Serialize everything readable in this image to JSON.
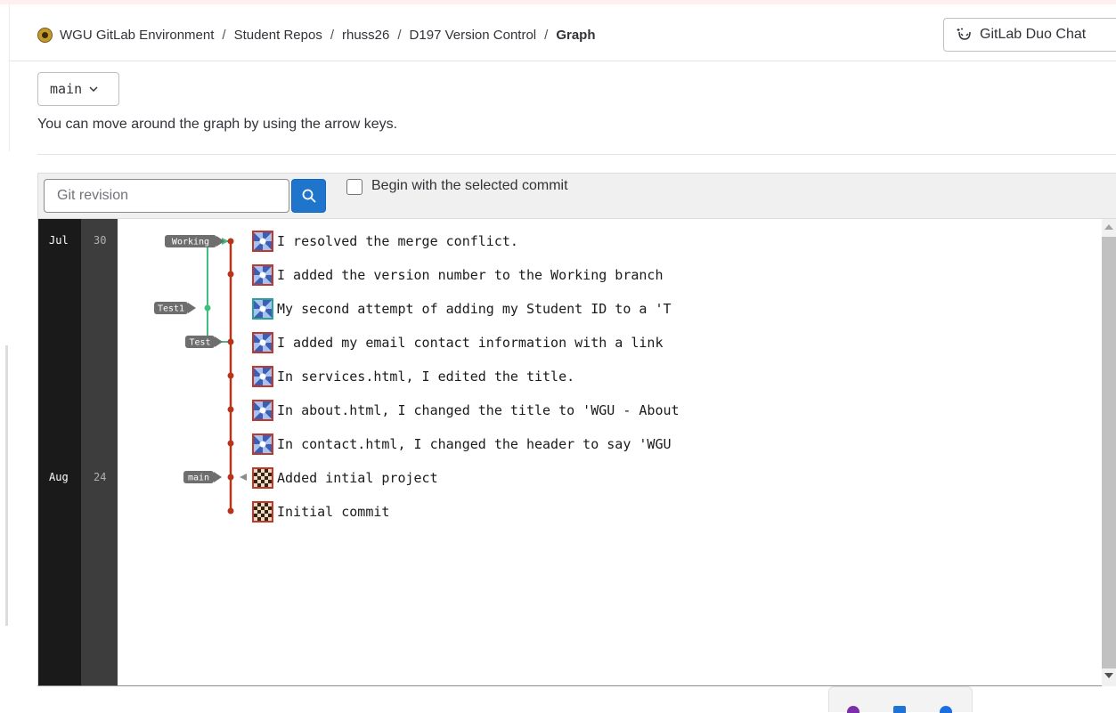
{
  "breadcrumb": {
    "items": [
      "WGU GitLab Environment",
      "Student Repos",
      "rhuss26",
      "D197 Version Control",
      "Graph"
    ],
    "separator": "/"
  },
  "duo_chat": {
    "label": "GitLab Duo Chat",
    "icon": "duo-chat-icon"
  },
  "branch_selector": {
    "value": "main",
    "icon": "chevron-down-icon"
  },
  "help_text": "You can move around the graph by using the arrow keys.",
  "toolbar": {
    "revision_placeholder": "Git revision",
    "revision_value": "",
    "search_icon": "search-icon",
    "begin_with_selected_label": "Begin with the selected commit",
    "begin_with_selected_checked": false
  },
  "dates": [
    {
      "month": "Jul",
      "day": "30"
    },
    {
      "month": "Aug",
      "day": "24"
    }
  ],
  "branch_labels": [
    "Working",
    "Test1",
    "Test",
    "main"
  ],
  "commits": [
    {
      "message": "I resolved the merge conflict.",
      "avatar": "blue"
    },
    {
      "message": "I added the version number to the Working branch",
      "avatar": "blue"
    },
    {
      "message": "My second attempt of adding my Student ID to a 'T",
      "avatar": "teal"
    },
    {
      "message": "I added my email contact information with a link",
      "avatar": "blue"
    },
    {
      "message": "In services.html, I edited the title.",
      "avatar": "blue"
    },
    {
      "message": "In about.html, I changed the title to 'WGU - About",
      "avatar": "blue"
    },
    {
      "message": "In contact.html, I changed the header to say 'WGU",
      "avatar": "blue"
    },
    {
      "message": "Added intial project",
      "avatar": "brown"
    },
    {
      "message": "Initial commit",
      "avatar": "brown"
    }
  ],
  "colors": {
    "main_line": "#b5351d",
    "branch_line": "#3fbf7f",
    "label_bg": "#6e6e6e",
    "search_button": "#1f75cb",
    "month_column": "#1a1a1a",
    "day_column": "#3d3d3d"
  }
}
